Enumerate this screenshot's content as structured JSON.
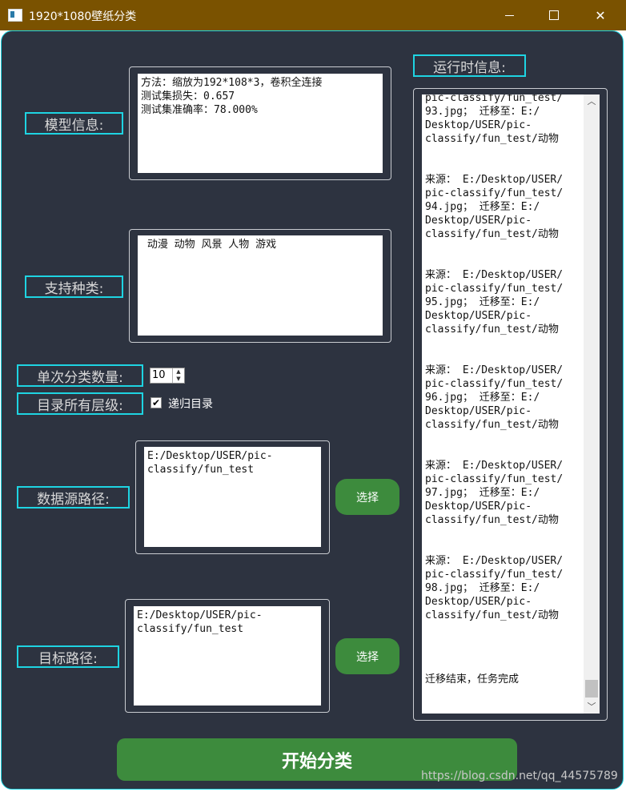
{
  "window": {
    "title": "1920*1080壁纸分类"
  },
  "model": {
    "label": "模型信息:",
    "text": "方法：缩放为192*108*3，卷积全连接\n测试集损失：0.657\n测试集准确率：78.000%"
  },
  "categories": {
    "label": "支持种类:",
    "text": " 动漫 动物 风景 人物 游戏"
  },
  "batch": {
    "label": "单次分类数量:",
    "value": "10"
  },
  "recursion": {
    "label": "目录所有层级:",
    "checkbox_label": "递归目录",
    "checked": true
  },
  "source": {
    "label": "数据源路径:",
    "path": "E:/Desktop/USER/pic-\nclassify/fun_test",
    "button": "选择"
  },
  "target": {
    "label": "目标路径:",
    "path": "E:/Desktop/USER/pic-\nclassify/fun_test",
    "button": "选择"
  },
  "runtime": {
    "label": "运行时信息:",
    "entries": [
      "pic-classify/fun_test/\n93.jpg； 迁移至：E:/\nDesktop/USER/pic-\nclassify/fun_test/动物",
      "来源： E:/Desktop/USER/\npic-classify/fun_test/\n94.jpg； 迁移至：E:/\nDesktop/USER/pic-\nclassify/fun_test/动物",
      "来源： E:/Desktop/USER/\npic-classify/fun_test/\n95.jpg； 迁移至：E:/\nDesktop/USER/pic-\nclassify/fun_test/动物",
      "来源： E:/Desktop/USER/\npic-classify/fun_test/\n96.jpg； 迁移至：E:/\nDesktop/USER/pic-\nclassify/fun_test/动物",
      "来源： E:/Desktop/USER/\npic-classify/fun_test/\n97.jpg； 迁移至：E:/\nDesktop/USER/pic-\nclassify/fun_test/动物",
      "来源： E:/Desktop/USER/\npic-classify/fun_test/\n98.jpg； 迁移至：E:/\nDesktop/USER/pic-\nclassify/fun_test/动物"
    ],
    "final": "迁移结束，任务完成"
  },
  "start_button": "开始分类",
  "watermark": "https://blog.csdn.net/qq_44575789"
}
